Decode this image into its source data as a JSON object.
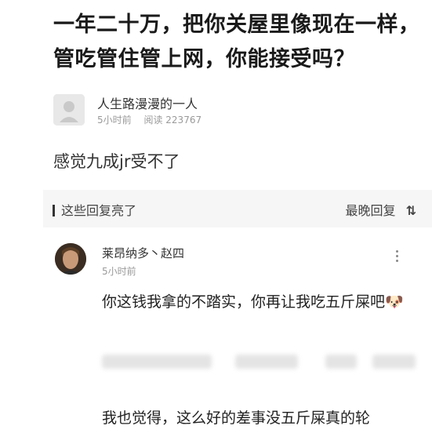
{
  "post": {
    "title": "一年二十万，把你关屋里像现在一样，管吃管住管上网，你能接受吗？",
    "author": "人生路漫漫的一人",
    "time": "5小时前",
    "views": "阅读 223767",
    "body": "感觉九成jr受不了"
  },
  "hot_section": {
    "label": "这些回复亮了",
    "sort_label": "最晚回复",
    "sort_icon": "⇅"
  },
  "comment": {
    "author": "莱昂纳多丶赵四",
    "time": "5小时前",
    "text": "你这钱我拿的不踏实，你再让我吃五斤屎吧🐶"
  },
  "next_comment": {
    "text_preview": "我也觉得，这么好的差事没五斤屎真的轮"
  }
}
